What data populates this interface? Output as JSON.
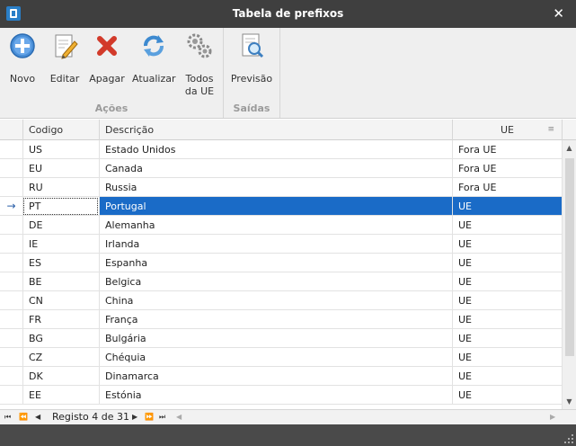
{
  "window": {
    "title": "Tabela de prefixos",
    "close": "✕"
  },
  "ribbon": {
    "groups": {
      "acoes": "Ações",
      "saidas": "Saídas"
    },
    "buttons": {
      "novo": "Novo",
      "editar": "Editar",
      "apagar": "Apagar",
      "atualizar": "Atualizar",
      "todos_line1": "Todos",
      "todos_line2": "da UE",
      "previsao": "Previsão"
    },
    "icons": {
      "novo": "add-circle-icon",
      "editar": "edit-pencil-icon",
      "apagar": "delete-x-icon",
      "atualizar": "refresh-icon",
      "todos": "gears-icon",
      "previsao": "print-preview-icon"
    }
  },
  "grid": {
    "columns": {
      "code": "Codigo",
      "desc": "Descrição",
      "ue": "UE"
    },
    "selected_indicator": "→",
    "selected_index": 3,
    "rows": [
      {
        "code": "US",
        "desc": "Estado Unidos",
        "ue": "Fora UE"
      },
      {
        "code": "EU",
        "desc": "Canada",
        "ue": "Fora UE"
      },
      {
        "code": "RU",
        "desc": "Russia",
        "ue": "Fora UE"
      },
      {
        "code": "PT",
        "desc": "Portugal",
        "ue": "UE"
      },
      {
        "code": "DE",
        "desc": "Alemanha",
        "ue": "UE"
      },
      {
        "code": "IE",
        "desc": "Irlanda",
        "ue": "UE"
      },
      {
        "code": "ES",
        "desc": "Espanha",
        "ue": "UE"
      },
      {
        "code": "BE",
        "desc": "Belgica",
        "ue": "UE"
      },
      {
        "code": "CN",
        "desc": "China",
        "ue": "UE"
      },
      {
        "code": "FR",
        "desc": "França",
        "ue": "UE"
      },
      {
        "code": "BG",
        "desc": "Bulgária",
        "ue": "UE"
      },
      {
        "code": "CZ",
        "desc": "Chéquia",
        "ue": "UE"
      },
      {
        "code": "DK",
        "desc": "Dinamarca",
        "ue": "UE"
      },
      {
        "code": "EE",
        "desc": "Estónia",
        "ue": "UE"
      }
    ]
  },
  "navigator": {
    "record_text": "Registo 4 de 31"
  },
  "colors": {
    "selection": "#1a6bc7",
    "titlebar": "#3f3f3f",
    "statusbar": "#4a4a4a"
  }
}
